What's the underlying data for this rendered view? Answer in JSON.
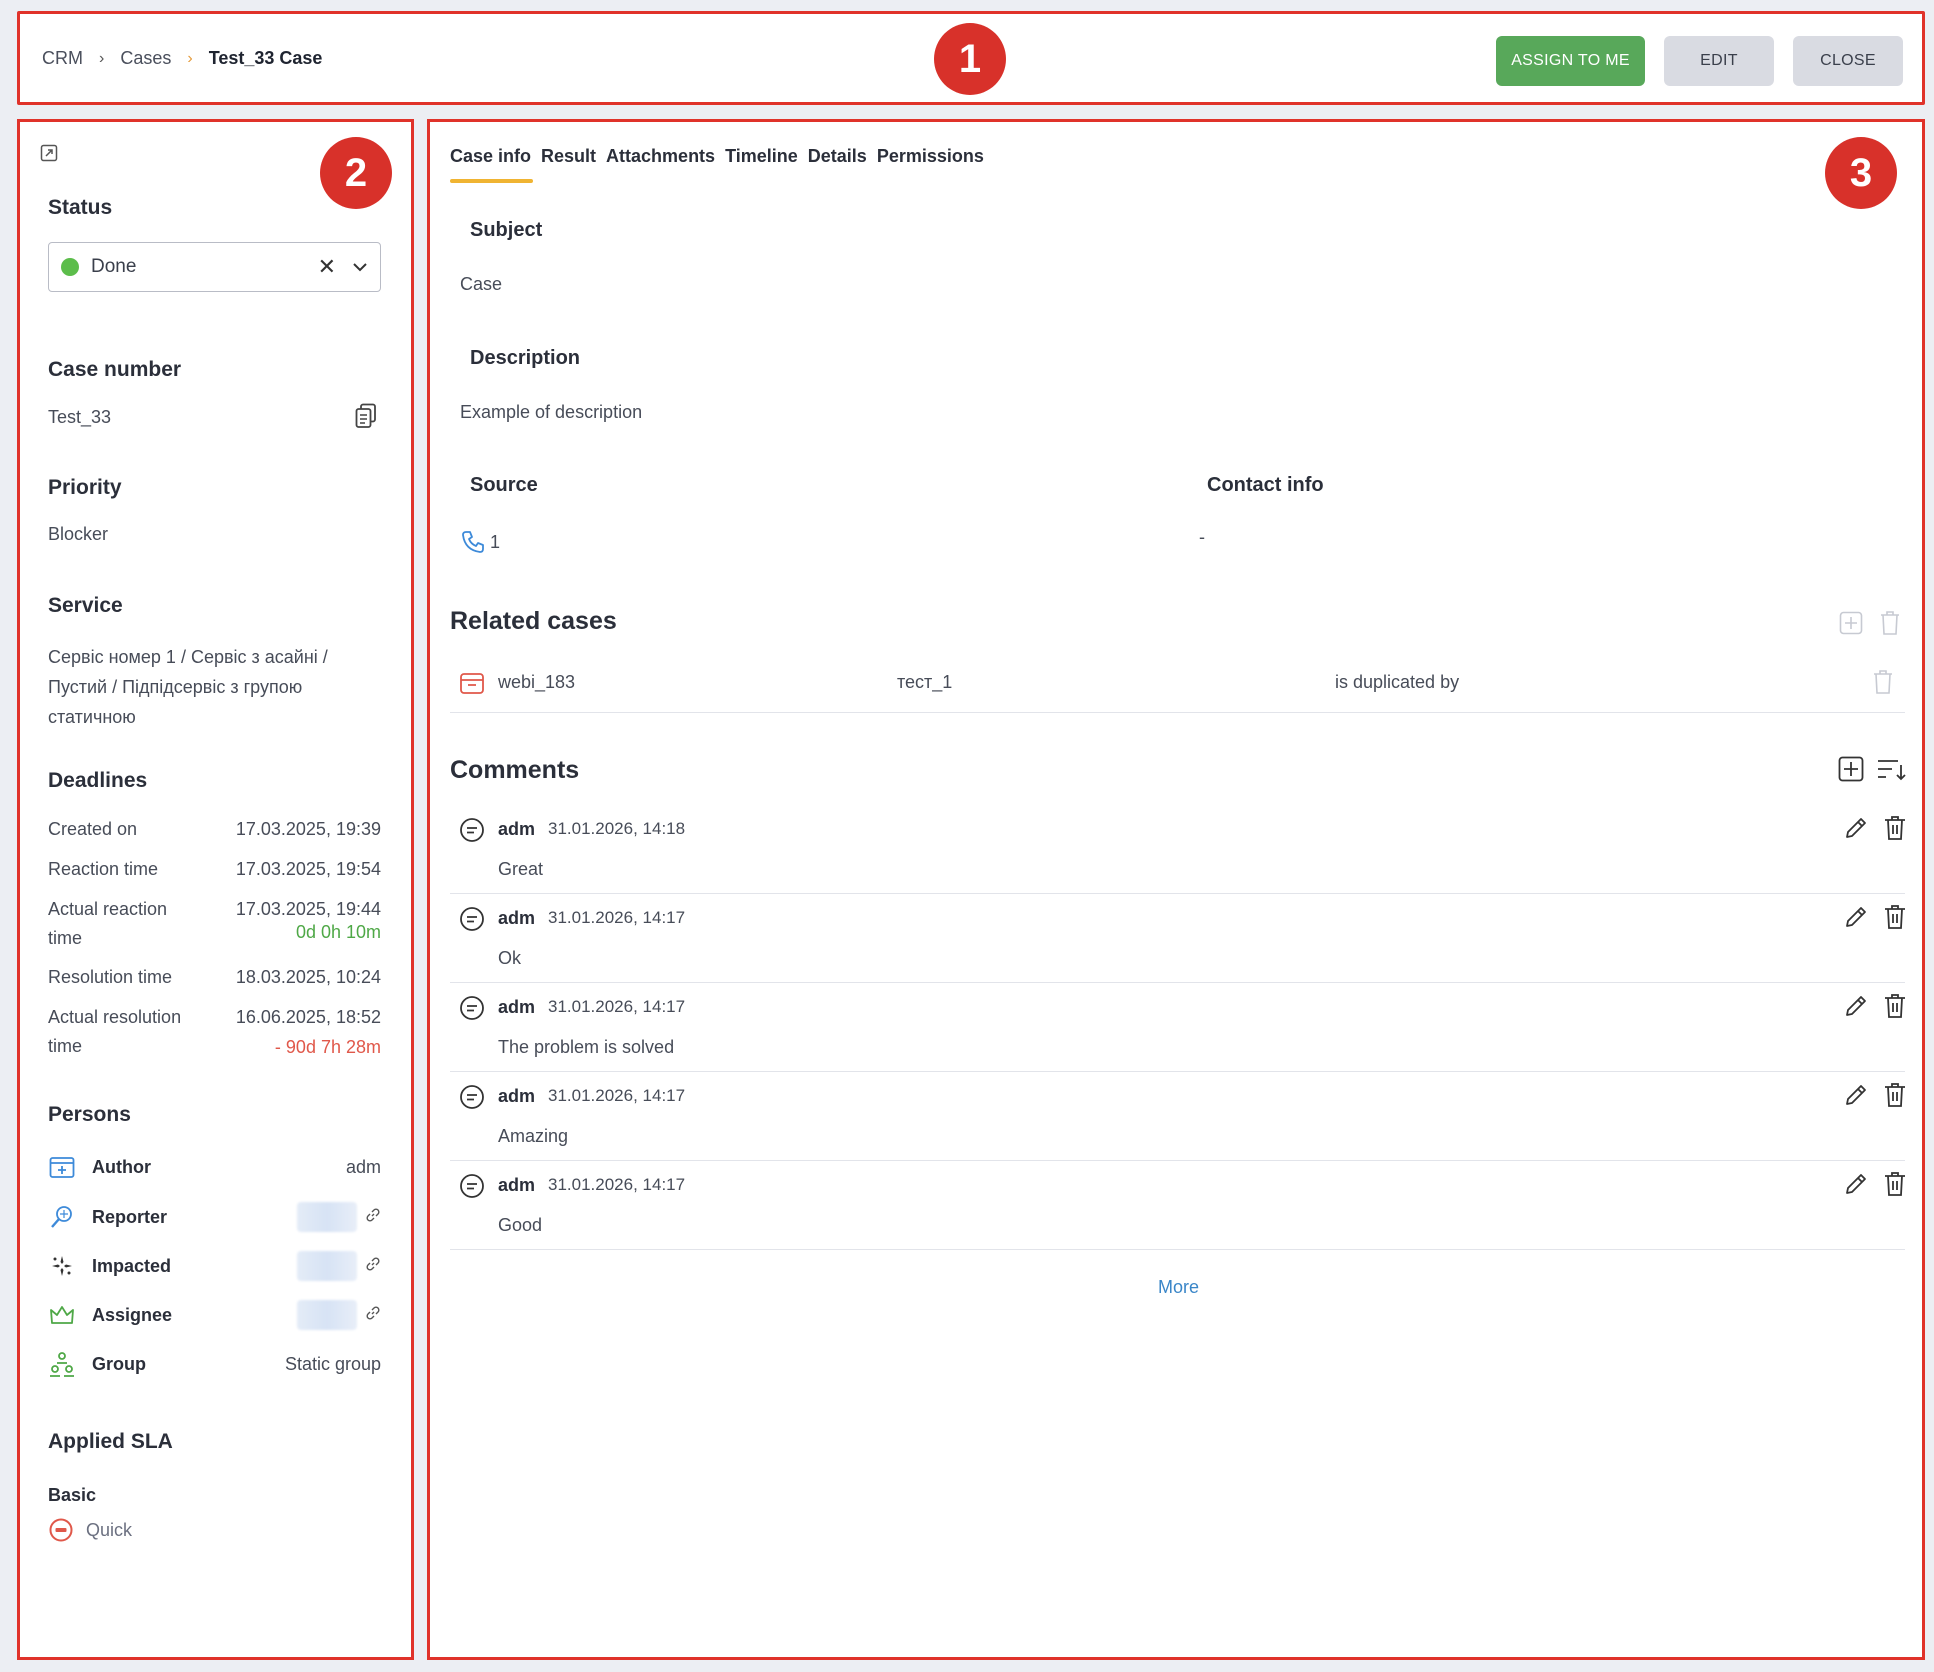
{
  "header": {
    "breadcrumb": [
      "CRM",
      "Cases",
      "Test_33 Case"
    ],
    "buttons": {
      "assign": "ASSIGN TO ME",
      "edit": "EDIT",
      "close": "CLOSE"
    },
    "badge": "1"
  },
  "left": {
    "badge": "2",
    "status": {
      "title": "Status",
      "value": "Done",
      "dot_color": "#5cbd4b"
    },
    "case_number": {
      "title": "Case number",
      "value": "Test_33"
    },
    "priority": {
      "title": "Priority",
      "value": "Blocker"
    },
    "service": {
      "title": "Service",
      "lines": [
        "Сервіс номер 1 / Сервіс з асайні /",
        "Пустий / Підпідсервіс з групою",
        "статичною"
      ]
    },
    "deadlines": {
      "title": "Deadlines",
      "rows": [
        {
          "label": "Created on",
          "value": "17.03.2025, 19:39"
        },
        {
          "label": "Reaction time",
          "value": "17.03.2025, 19:54"
        },
        {
          "label": "Actual reaction",
          "label2": "time",
          "value": "17.03.2025, 19:44",
          "extra": "0d 0h 10m",
          "extra_color": "#4fa847"
        },
        {
          "label": "Resolution time",
          "value": "18.03.2025, 10:24"
        },
        {
          "label": "Actual resolution",
          "label2": "time",
          "value": "16.06.2025, 18:52",
          "extra": "- 90d 7h 28m",
          "extra_color": "#e0584a"
        }
      ]
    },
    "persons": {
      "title": "Persons",
      "rows": [
        {
          "label": "Author",
          "value": "adm",
          "icon": "author-icon"
        },
        {
          "label": "Reporter",
          "value": "",
          "icon": "reporter-icon"
        },
        {
          "label": "Impacted",
          "value": "",
          "icon": "impacted-icon"
        },
        {
          "label": "Assignee",
          "value": "",
          "icon": "assignee-icon"
        },
        {
          "label": "Group",
          "value": "Static group",
          "icon": "group-icon"
        }
      ]
    },
    "sla": {
      "title": "Applied SLA",
      "name": "Basic",
      "item": "Quick"
    }
  },
  "main": {
    "badge": "3",
    "tabs": [
      "Case info",
      "Result",
      "Attachments",
      "Timeline",
      "Details",
      "Permissions"
    ],
    "subject": {
      "label": "Subject",
      "value": "Case"
    },
    "description": {
      "label": "Description",
      "value": "Example of description"
    },
    "source": {
      "label": "Source",
      "value": "1"
    },
    "contact": {
      "label": "Contact info",
      "value": "-"
    },
    "related": {
      "title": "Related cases",
      "rows": [
        {
          "id": "webi_183",
          "name": "тест_1",
          "relation": "is duplicated by"
        }
      ]
    },
    "comments": {
      "title": "Comments",
      "items": [
        {
          "author": "adm",
          "time": "31.01.2026, 14:18",
          "text": "Great"
        },
        {
          "author": "adm",
          "time": "31.01.2026, 14:17",
          "text": "Ok"
        },
        {
          "author": "adm",
          "time": "31.01.2026, 14:17",
          "text": "The problem is solved"
        },
        {
          "author": "adm",
          "time": "31.01.2026, 14:17",
          "text": "Amazing"
        },
        {
          "author": "adm",
          "time": "31.01.2026, 14:17",
          "text": "Good"
        }
      ],
      "more": "More"
    }
  }
}
